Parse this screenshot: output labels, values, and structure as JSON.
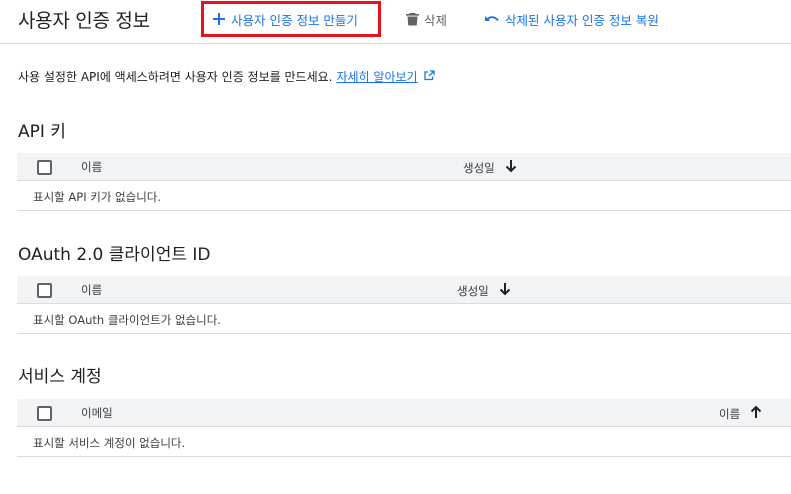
{
  "header": {
    "title": "사용자 인증 정보",
    "create_label": "사용자 인증 정보 만들기",
    "delete_label": "삭제",
    "restore_label": "삭제된 사용자 인증 정보 복원"
  },
  "info": {
    "text": "사용 설정한 API에 액세스하려면 사용자 인증 정보를 만드세요.",
    "link_label": "자세히 알아보기"
  },
  "sections": {
    "api_keys": {
      "title": "API 키",
      "col_name": "이름",
      "col_date": "생성일",
      "empty": "표시할 API 키가 없습니다."
    },
    "oauth": {
      "title": "OAuth 2.0 클라이언트 ID",
      "col_name": "이름",
      "col_date": "생성일",
      "empty": "표시할 OAuth 클라이언트가 없습니다."
    },
    "service_accounts": {
      "title": "서비스 계정",
      "col_email": "이메일",
      "col_name": "이름",
      "empty": "표시할 서비스 계정이 없습니다."
    }
  },
  "colors": {
    "accent": "#1a73e8",
    "highlight": "#e8121a",
    "header_bg": "#f1f3f4",
    "divider": "#dadce0"
  },
  "icons": {
    "create": "plus-icon",
    "delete": "trash-icon",
    "restore": "undo-icon",
    "external": "external-link-icon",
    "sort_desc": "arrow-down-icon",
    "sort_asc": "arrow-up-icon"
  }
}
